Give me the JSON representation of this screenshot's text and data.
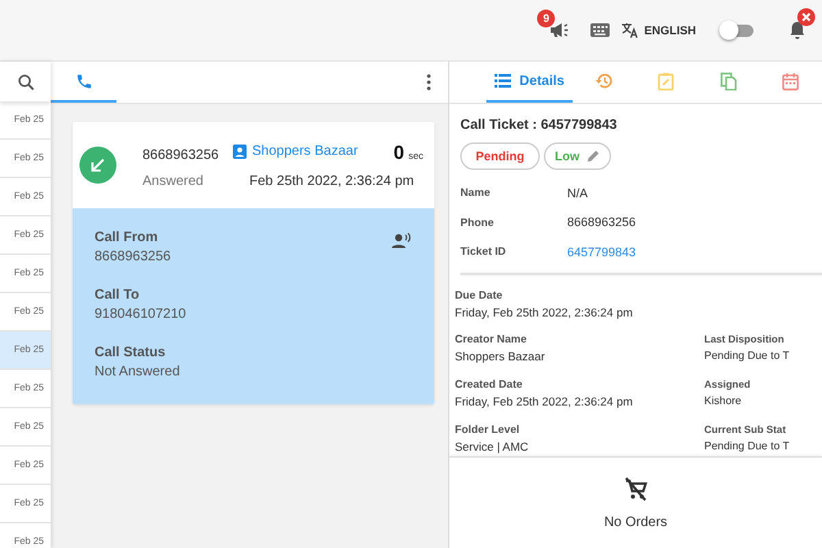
{
  "top_bar": {
    "announcement_badge": "9",
    "language": "ENGLISH",
    "toggle": {
      "on": false
    }
  },
  "date_list": [
    {
      "label": "Feb 25",
      "selected": false
    },
    {
      "label": "Feb 25",
      "selected": false
    },
    {
      "label": "Feb 25",
      "selected": false
    },
    {
      "label": "Feb 25",
      "selected": false
    },
    {
      "label": "Feb 25",
      "selected": false
    },
    {
      "label": "Feb 25",
      "selected": false
    },
    {
      "label": "Feb 25",
      "selected": true
    },
    {
      "label": "Feb 25",
      "selected": false
    },
    {
      "label": "Feb 25",
      "selected": false
    },
    {
      "label": "Feb 25",
      "selected": false
    },
    {
      "label": "Feb 25",
      "selected": false
    },
    {
      "label": "Feb 25",
      "selected": false
    }
  ],
  "call_tab": {
    "selected": true
  },
  "call": {
    "number": "8668963256",
    "contact": "Shoppers Bazaar",
    "duration": "0",
    "duration_unit": "sec",
    "status": "Answered",
    "datetime": "Feb 25th 2022, 2:36:24 pm",
    "details": [
      {
        "label": "Call From",
        "value": "8668963256"
      },
      {
        "label": "Call To",
        "value": "918046107210"
      },
      {
        "label": "Call Status",
        "value": "Not Answered"
      }
    ]
  },
  "detail_tabs": [
    {
      "kind": "details",
      "label": "Details",
      "selected": true
    },
    {
      "kind": "history",
      "selected": false
    },
    {
      "kind": "note",
      "selected": false
    },
    {
      "kind": "copy",
      "selected": false
    },
    {
      "kind": "calendar",
      "selected": false
    }
  ],
  "ticket": {
    "title": "Call Ticket : 6457799843",
    "status": "Pending",
    "priority": "Low",
    "fields": [
      {
        "label": "Name",
        "value": "N/A",
        "kind": "text"
      },
      {
        "label": "Phone",
        "value": "8668963256",
        "kind": "text"
      },
      {
        "label": "Ticket ID",
        "value": "6457799843",
        "kind": "link"
      }
    ],
    "info": [
      {
        "left": {
          "label": "Due Date",
          "value": "Friday, Feb 25th 2022, 2:36:24 pm"
        }
      },
      {
        "left": {
          "label": "Creator Name",
          "value": "Shoppers Bazaar"
        },
        "right": {
          "label": "Last Disposition",
          "value": "Pending Due to T"
        }
      },
      {
        "left": {
          "label": "Created Date",
          "value": "Friday, Feb 25th 2022, 2:36:24 pm"
        },
        "right": {
          "label": "Assigned",
          "value": "Kishore"
        }
      },
      {
        "left": {
          "label": "Folder Level",
          "value": "Service | AMC"
        },
        "right": {
          "label": "Current Sub Stat",
          "value": "Pending Due to T"
        }
      }
    ]
  },
  "orders": {
    "empty_text": "No Orders"
  }
}
